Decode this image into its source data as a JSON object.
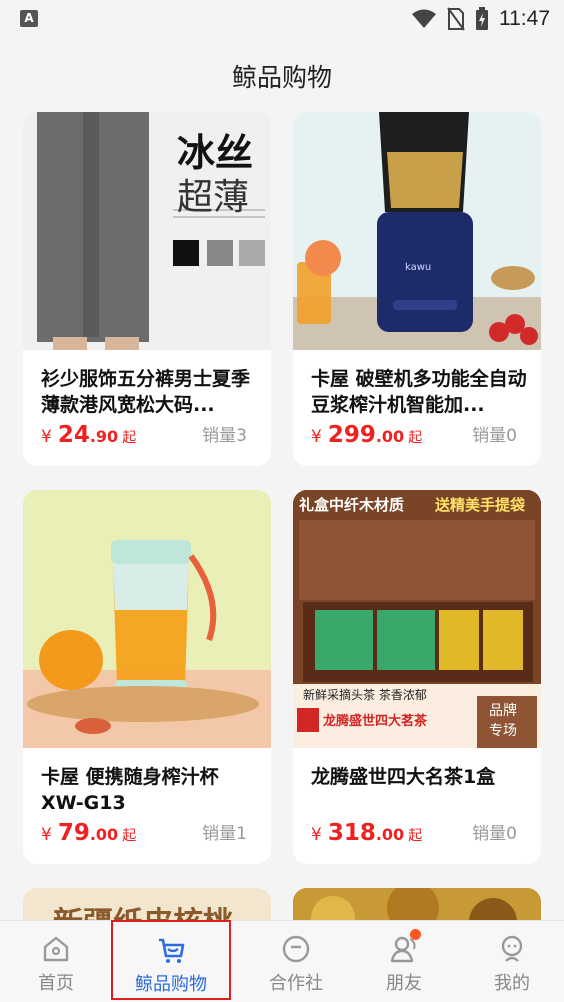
{
  "status_bar": {
    "time": "11:47"
  },
  "header": {
    "title": "鲸品购物"
  },
  "products": [
    {
      "title": "衫少服饰五分裤男士夏季薄款港风宽松大码...",
      "price_symbol": "¥",
      "price_int": "24",
      "price_dec": ".90",
      "price_suffix": "起",
      "sales": "销量3",
      "image_text": [
        "冰丝",
        "超薄"
      ]
    },
    {
      "title": "卡屋 破壁机多功能全自动豆浆榨汁机智能加...",
      "price_symbol": "¥",
      "price_int": "299",
      "price_dec": ".00",
      "price_suffix": "起",
      "sales": "销量0",
      "image_text": [
        "kawu"
      ]
    },
    {
      "title": "卡屋 便携随身榨汁杯XW-G13",
      "price_symbol": "¥",
      "price_int": "79",
      "price_dec": ".00",
      "price_suffix": "起",
      "sales": "销量1",
      "image_text": []
    },
    {
      "title": "龙腾盛世四大名茶1盒",
      "price_symbol": "¥",
      "price_int": "318",
      "price_dec": ".00",
      "price_suffix": "起",
      "sales": "销量0",
      "image_text": [
        "礼盒中纤木材质",
        "送精美手提袋",
        "新鲜采摘头茶 茶香浓郁",
        "龙腾盛世四大茗茶",
        "品牌",
        "专场"
      ]
    },
    {
      "title": "",
      "image_text": [
        "新疆纸皮核桃"
      ]
    },
    {
      "title": "",
      "image_text": []
    }
  ],
  "tabs": [
    {
      "label": "首页",
      "icon": "home-icon"
    },
    {
      "label": "鲸品购物",
      "icon": "cart-icon"
    },
    {
      "label": "合作社",
      "icon": "minus-circle-icon"
    },
    {
      "label": "朋友",
      "icon": "friends-icon"
    },
    {
      "label": "我的",
      "icon": "profile-icon"
    }
  ],
  "colors": {
    "accent": "#2b6de0",
    "price": "#e22222",
    "badge": "#ff5722",
    "highlight_border": "#e02020"
  }
}
